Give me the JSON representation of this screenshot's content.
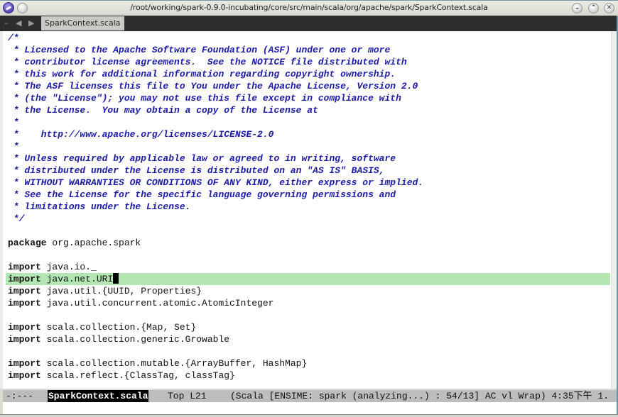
{
  "window": {
    "title": "/root/working/spark-0.9.0-incubating/core/src/main/scala/org/apache/spark/SparkContext.scala",
    "buttons": {
      "minimize": "⌄",
      "maximize": "⌃",
      "close": "✕"
    },
    "icons": [
      "app-menu-icon",
      "sticky-icon"
    ]
  },
  "tabbar": {
    "tools": {
      "dash": "–",
      "back": "◀",
      "forward": "▶"
    },
    "active_tab": "SparkContext.scala"
  },
  "editor": {
    "lines": [
      {
        "kind": "comment",
        "text": "/*"
      },
      {
        "kind": "comment",
        "text": " * Licensed to the Apache Software Foundation (ASF) under one or more"
      },
      {
        "kind": "comment",
        "text": " * contributor license agreements.  See the NOTICE file distributed with"
      },
      {
        "kind": "comment",
        "text": " * this work for additional information regarding copyright ownership."
      },
      {
        "kind": "comment",
        "text": " * The ASF licenses this file to You under the Apache License, Version 2.0"
      },
      {
        "kind": "comment",
        "text": " * (the \"License\"); you may not use this file except in compliance with"
      },
      {
        "kind": "comment",
        "text": " * the License.  You may obtain a copy of the License at"
      },
      {
        "kind": "comment",
        "text": " *"
      },
      {
        "kind": "comment",
        "text": " *    http://www.apache.org/licenses/LICENSE-2.0"
      },
      {
        "kind": "comment",
        "text": " *"
      },
      {
        "kind": "comment",
        "text": " * Unless required by applicable law or agreed to in writing, software"
      },
      {
        "kind": "comment",
        "text": " * distributed under the License is distributed on an \"AS IS\" BASIS,"
      },
      {
        "kind": "comment",
        "text": " * WITHOUT WARRANTIES OR CONDITIONS OF ANY KIND, either express or implied."
      },
      {
        "kind": "comment",
        "text": " * See the License for the specific language governing permissions and"
      },
      {
        "kind": "comment",
        "text": " * limitations under the License."
      },
      {
        "kind": "comment",
        "text": " */"
      },
      {
        "kind": "blank",
        "text": ""
      },
      {
        "kind": "code",
        "keyword": "package",
        "rest": " org.apache.spark"
      },
      {
        "kind": "blank",
        "text": ""
      },
      {
        "kind": "code",
        "keyword": "import",
        "rest": " java.io._"
      },
      {
        "kind": "code",
        "keyword": "import",
        "rest": " java.net.URI",
        "highlighted": true,
        "cursor": true
      },
      {
        "kind": "code",
        "keyword": "import",
        "rest": " java.util.{UUID, Properties}"
      },
      {
        "kind": "code",
        "keyword": "import",
        "rest": " java.util.concurrent.atomic.AtomicInteger"
      },
      {
        "kind": "blank",
        "text": ""
      },
      {
        "kind": "code",
        "keyword": "import",
        "rest": " scala.collection.{Map, Set}"
      },
      {
        "kind": "code",
        "keyword": "import",
        "rest": " scala.collection.generic.Growable"
      },
      {
        "kind": "blank",
        "text": ""
      },
      {
        "kind": "code",
        "keyword": "import",
        "rest": " scala.collection.mutable.{ArrayBuffer, HashMap}"
      },
      {
        "kind": "code",
        "keyword": "import",
        "rest": " scala.reflect.{ClassTag, classTag}"
      }
    ]
  },
  "modeline": {
    "status": "-:---",
    "buffer_name": "SparkContext.scala",
    "position": "Top L21",
    "modes": "(Scala [ENSIME: spark (analyzing...) : 54/13] AC vl Wrap) 4:35下午 1."
  },
  "colors": {
    "comment": "#1a1aa6",
    "highlight_line": "#b4e6b4",
    "modeline_bg": "#bdbdbd",
    "tabbar_bg": "#2e2e2e"
  }
}
